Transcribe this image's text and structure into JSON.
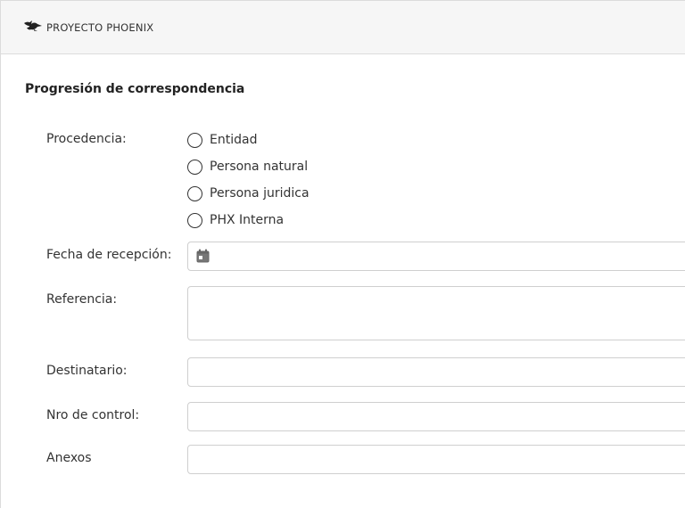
{
  "header": {
    "app_name": "PROYECTO PHOENIX",
    "logo_icon": "phoenix-logo-icon"
  },
  "form": {
    "title": "Progresión de correspondencia",
    "procedencia": {
      "label": "Procedencia:",
      "options": [
        "Entidad",
        "Persona natural",
        "Persona juridica",
        "PHX Interna"
      ],
      "selected": null
    },
    "fecha": {
      "label": "Fecha de recepción:",
      "value": "",
      "icon": "calendar-icon"
    },
    "referencia": {
      "label": "Referencia:",
      "value": ""
    },
    "destinatario": {
      "label": "Destinatario:",
      "value": ""
    },
    "nro_control": {
      "label": "Nro de control:",
      "value": ""
    },
    "anexos": {
      "label": "Anexos",
      "value": ""
    }
  }
}
